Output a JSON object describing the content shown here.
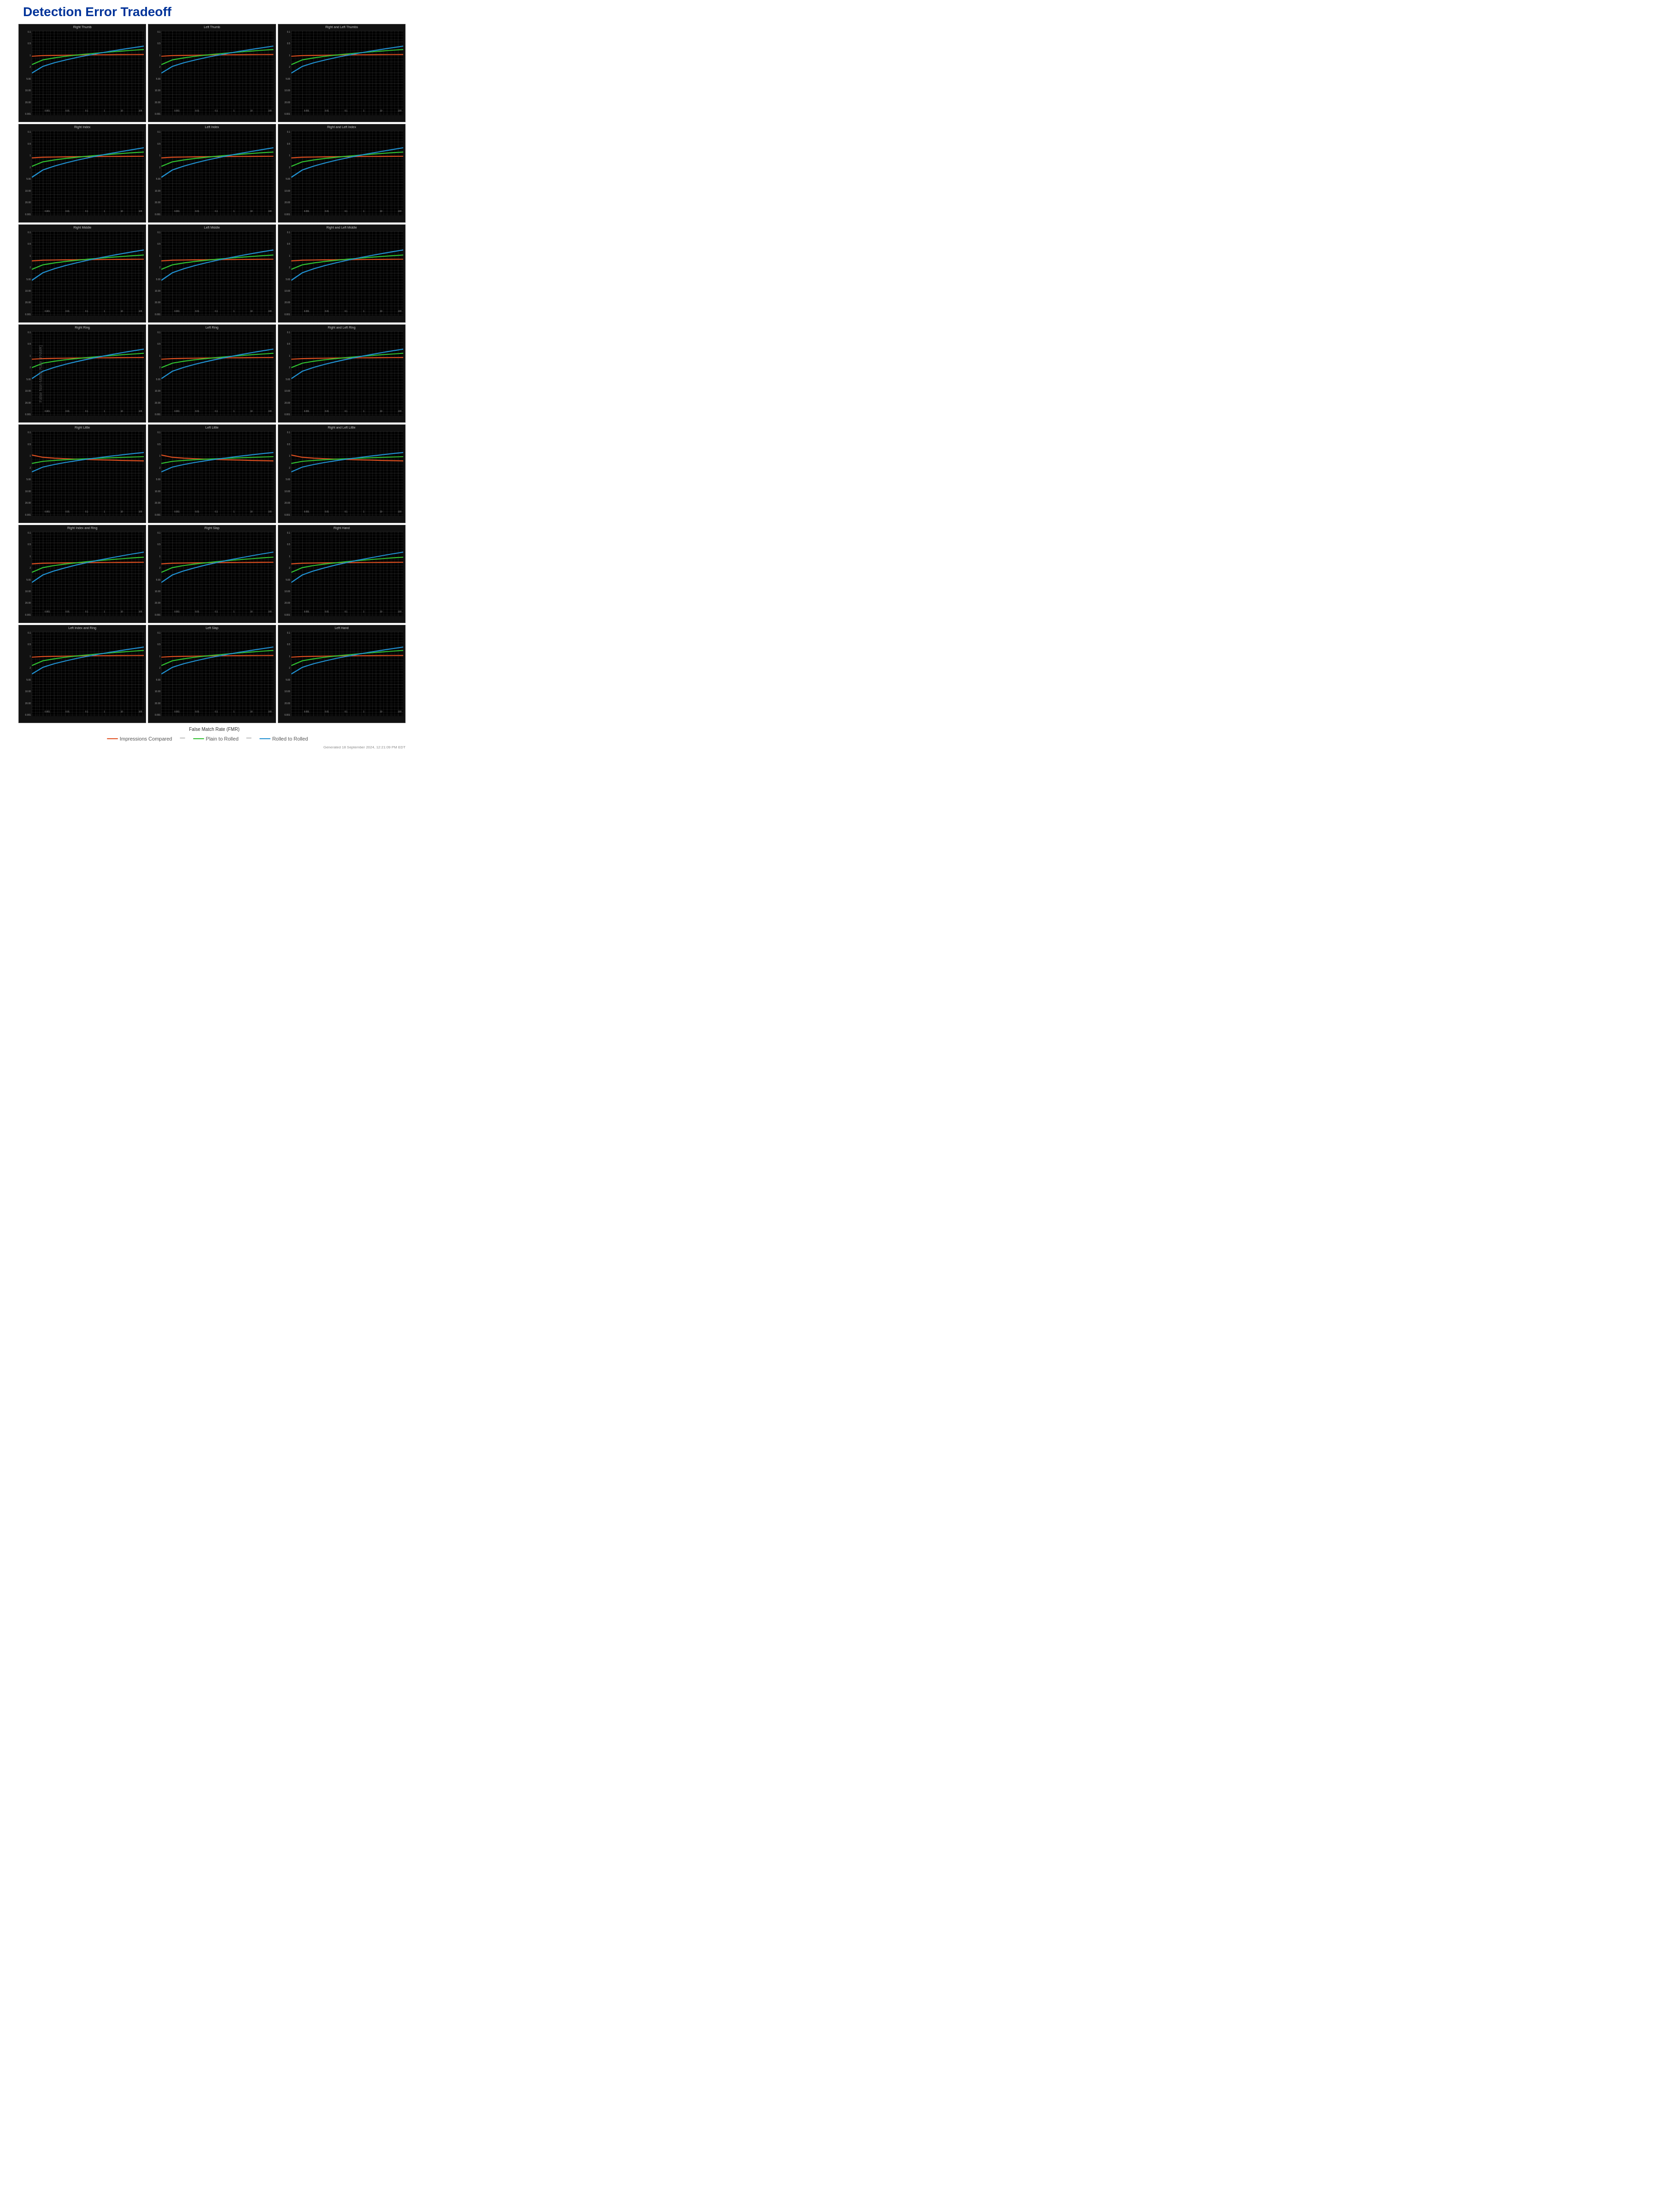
{
  "title": "Detection Error Tradeoff",
  "y_axis_title": "False Non-Match Rate (FNMR)",
  "x_axis_title": "False Match Rate (FMR)",
  "footer": "Generated 18 September 2024, 12:21:09 PM EDT",
  "legend": {
    "items": [
      {
        "label": "Impressions Compared",
        "color": "#e05020"
      },
      {
        "label": "Plain to Rolled",
        "color": "#30c030"
      },
      {
        "label": "Rolled to Rolled",
        "color": "#2090d0"
      }
    ]
  },
  "x_labels": [
    "0.001",
    "0.01",
    "0.1 0.2 0.5 1",
    "0 2 5 10",
    "20 50 100"
  ],
  "y_labels": [
    "0.1",
    "0.5",
    "1",
    "2",
    "5.00",
    "10.00",
    "20.00",
    "0.001"
  ],
  "rows": [
    {
      "charts": [
        {
          "title": "Right Thumb"
        },
        {
          "title": "Left Thumb"
        },
        {
          "title": "Right and Left Thumbs"
        }
      ]
    },
    {
      "charts": [
        {
          "title": "Right Index"
        },
        {
          "title": "Left Index"
        },
        {
          "title": "Right and Left Index"
        }
      ]
    },
    {
      "charts": [
        {
          "title": "Right Middle"
        },
        {
          "title": "Left Middle"
        },
        {
          "title": "Right and Left Middle"
        }
      ]
    },
    {
      "charts": [
        {
          "title": "Right Ring"
        },
        {
          "title": "Left Ring"
        },
        {
          "title": "Right and Left Ring"
        }
      ]
    },
    {
      "charts": [
        {
          "title": "Right Little"
        },
        {
          "title": "Left Little"
        },
        {
          "title": "Right and Left Little"
        }
      ]
    },
    {
      "charts": [
        {
          "title": "Right Index and Ring"
        },
        {
          "title": "Right Slap"
        },
        {
          "title": "Right Hand"
        }
      ]
    },
    {
      "charts": [
        {
          "title": "Left Index and Ring"
        },
        {
          "title": "Left Slap"
        },
        {
          "title": "Left Hand"
        }
      ]
    }
  ]
}
